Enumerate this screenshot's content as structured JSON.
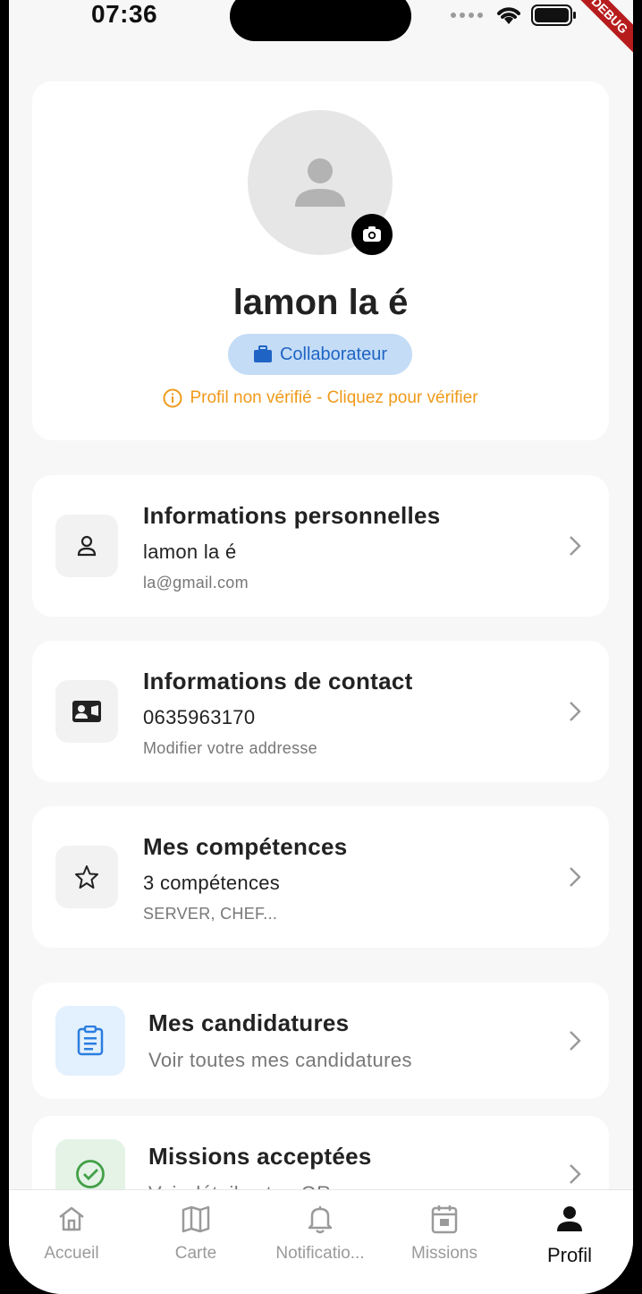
{
  "status_bar": {
    "time": "07:36",
    "debug": "DEBUG"
  },
  "profile": {
    "name": "lamon la é",
    "role": "Collaborateur",
    "verification": "Profil non vérifié - Cliquez pour vérifier"
  },
  "items": [
    {
      "title": "Informations personnelles",
      "line1": "lamon la é",
      "line2": "la@gmail.com",
      "icon": "person-outline-icon"
    },
    {
      "title": "Informations de contact",
      "line1": "0635963170",
      "line2": "Modifier votre addresse",
      "icon": "contact-card-icon"
    },
    {
      "title": "Mes compétences",
      "line1": "3 compétences",
      "line2": "SERVER, CHEF...",
      "icon": "star-outline-icon"
    },
    {
      "title": "Mes candidatures",
      "line1": "Voir toutes mes candidatures",
      "icon": "clipboard-icon",
      "accent": "#e3f0fd"
    },
    {
      "title": "Missions acceptées",
      "line1": "Voir détails et ... QR ...",
      "icon": "check-circle-icon",
      "accent": "#e4f3e6"
    }
  ],
  "tabs": [
    {
      "label": "Accueil",
      "icon": "home-icon"
    },
    {
      "label": "Carte",
      "icon": "map-icon"
    },
    {
      "label": "Notificatio...",
      "icon": "bell-icon"
    },
    {
      "label": "Missions",
      "icon": "calendar-icon"
    },
    {
      "label": "Profil",
      "icon": "person-icon",
      "active": true
    }
  ],
  "colors": {
    "accent_blue": "#1f64c4",
    "warning": "#ef9a1a",
    "success": "#43a047"
  }
}
